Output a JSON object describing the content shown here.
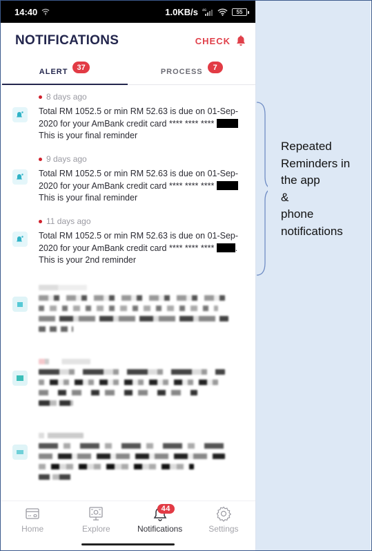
{
  "status_bar": {
    "time": "14:40",
    "network_speed": "1.0KB/s",
    "network_type": "4G",
    "battery": "55",
    "icons": [
      "wifi-icon",
      "signal-icon",
      "wifi-icon",
      "battery-icon"
    ]
  },
  "header": {
    "title": "NOTIFICATIONS",
    "check_label": "CHECK",
    "check_icon": "bell-icon"
  },
  "tabs": [
    {
      "label": "ALERT",
      "badge": "37",
      "active": true
    },
    {
      "label": "PROCESS",
      "badge": "7",
      "active": false
    }
  ],
  "notifications": [
    {
      "time": "8 days ago",
      "unread": true,
      "icon": "notification-bell-icon",
      "message_before_redaction": "Total RM 1052.5 or min RM 52.63 is due on 01-Sep-2020 for your AmBank credit card **** **** ****",
      "redacted": true,
      "message_after_redaction": "This is your final reminder"
    },
    {
      "time": "9 days ago",
      "unread": true,
      "icon": "notification-bell-icon",
      "message_before_redaction": "Total RM 1052.5 or min RM 52.63 is due on 01-Sep-2020 for your AmBank credit card **** **** ****",
      "redacted": true,
      "message_after_redaction": "This is your final reminder"
    },
    {
      "time": "11 days ago",
      "unread": true,
      "icon": "notification-bell-icon",
      "message_before_redaction": "Total RM 1052.5 or min RM 52.63 is due on 01-Sep-2020 for your AmBank credit card **** **** ****",
      "redacted": true,
      "message_after_redaction": ". This is your 2nd reminder"
    }
  ],
  "blurred_notifications_count": 3,
  "bottom_nav": [
    {
      "label": "Home",
      "icon": "card-icon",
      "active": false
    },
    {
      "label": "Explore",
      "icon": "monitor-icon",
      "active": false
    },
    {
      "label": "Notifications",
      "icon": "bell-icon",
      "active": true,
      "badge": "44"
    },
    {
      "label": "Settings",
      "icon": "gear-icon",
      "active": false
    }
  ],
  "annotation": {
    "text": "Repeated\nReminders in\nthe app\n&\nphone\nnotifications",
    "background": "#dde8f5",
    "brace_color": "#6f8cc4"
  },
  "colors": {
    "accent_red": "#e23b45",
    "title_navy": "#23264d",
    "icon_teal": "#2fb3c7"
  }
}
